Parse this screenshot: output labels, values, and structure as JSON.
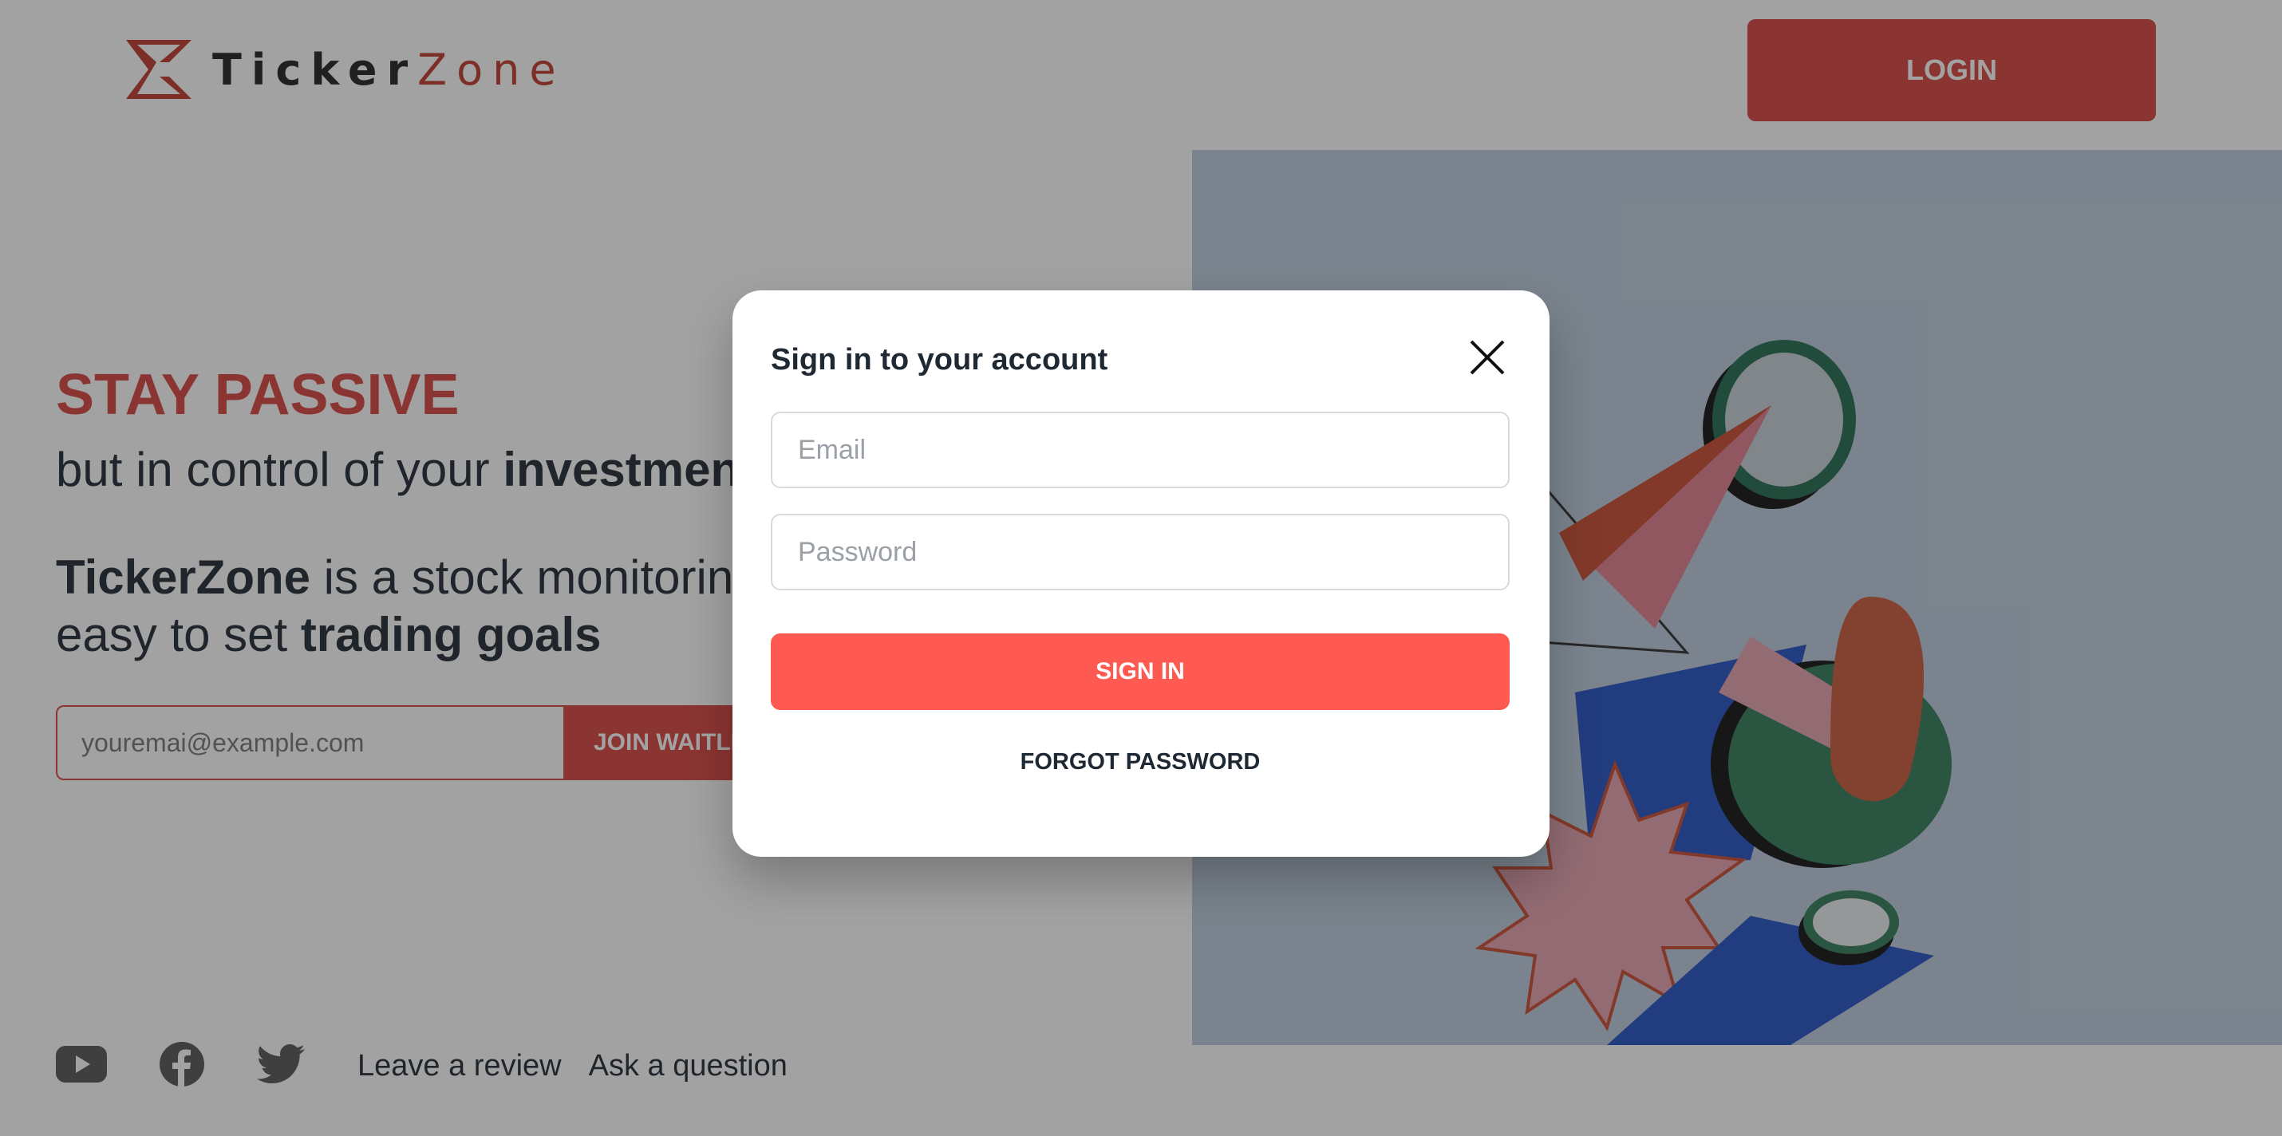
{
  "header": {
    "logo_text_a": "Ticker",
    "logo_text_b": "Zone",
    "login_label": "LOGIN"
  },
  "hero": {
    "headline": "STAY PASSIVE",
    "sub_lead": "but in control of your ",
    "sub_bold": "investments",
    "desc_brand": "TickerZone",
    "desc_mid": " is a stock monitoring tool that makes it",
    "desc_lead2": "easy to set ",
    "desc_bold2": "trading goals",
    "waitlist_placeholder": "youremai@example.com",
    "waitlist_button": "JOIN WAITLIST"
  },
  "footer": {
    "social_icons": [
      "youtube-icon",
      "facebook-icon",
      "twitter-icon"
    ],
    "links": [
      "Leave a review",
      "Ask a question"
    ]
  },
  "modal": {
    "title": "Sign in to your account",
    "email_placeholder": "Email",
    "password_placeholder": "Password",
    "signin_label": "SIGN IN",
    "forgot_label": "FORGOT PASSWORD"
  },
  "colors": {
    "brand_red": "#d7443e",
    "signin_red": "#fe5a51",
    "art_bg": "#bcccdc"
  }
}
